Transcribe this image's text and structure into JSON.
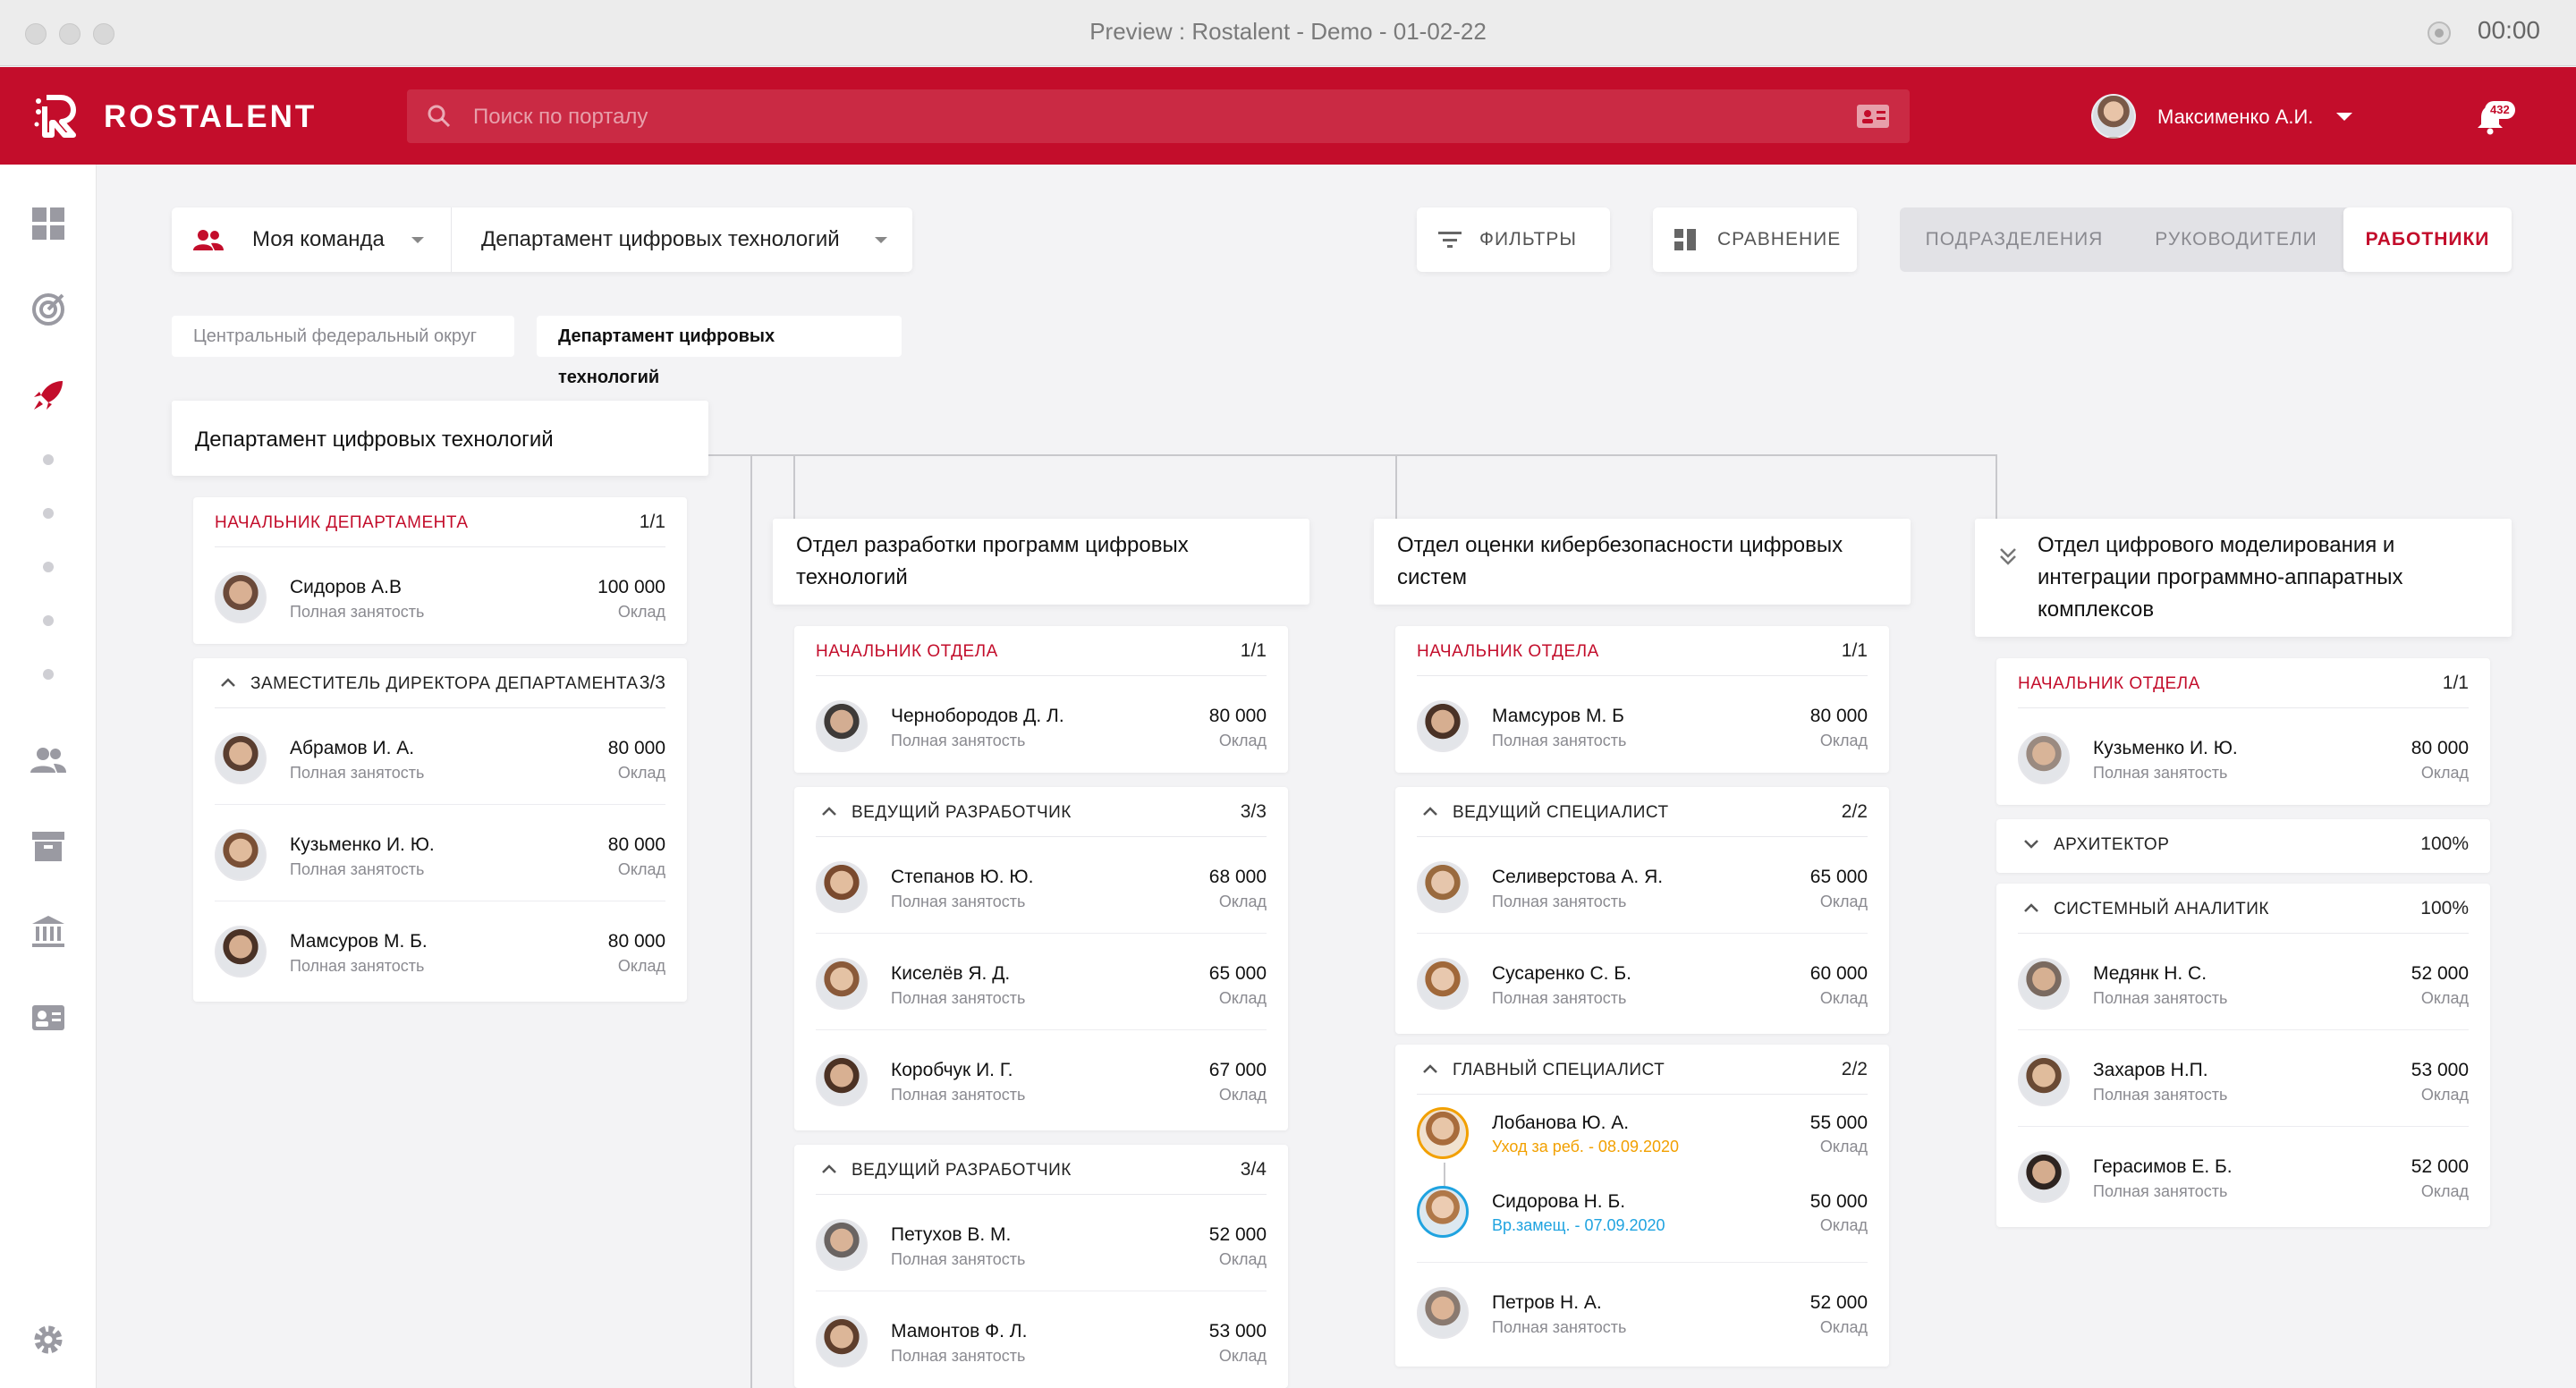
{
  "window": {
    "title": "Preview : Rostalent - Demo - 01-02-22",
    "timer": "00:00"
  },
  "app": {
    "brand": "ROSTALENT",
    "search_placeholder": "Поиск по порталу",
    "user_name": "Максименко А.И.",
    "notifications": "432"
  },
  "sidebar": {
    "icons": [
      "dashboard-icon",
      "target-icon",
      "rocket-icon",
      "team-icon",
      "archive-icon",
      "bank-icon",
      "id-card-icon",
      "settings-icon"
    ],
    "active": "rocket-icon"
  },
  "toolbar": {
    "team_select": "Моя команда",
    "dept_select": "Департамент цифровых технологий",
    "filters": "ФИЛЬТРЫ",
    "compare": "СРАВНЕНИЕ",
    "views": [
      "ПОДРАЗДЕЛЕНИЯ",
      "РУКОВОДИТЕЛИ",
      "РАБОТНИКИ"
    ],
    "active_view": "РАБОТНИКИ"
  },
  "breadcrumbs": [
    "Центральный федеральный округ",
    "Департамент цифровых технологий"
  ],
  "labels": {
    "employment": "Полная занятость",
    "salary": "Оклад"
  },
  "columns": [
    {
      "title": "Департамент цифровых технологий",
      "groups": [
        {
          "title": "НАЧАЛЬНИК ДЕПАРТАМЕНТА",
          "count": "1/1",
          "red": true,
          "employees": [
            {
              "name": "Сидоров А.В",
              "salary": "100 000"
            }
          ]
        },
        {
          "title": "ЗАМЕСТИТЕЛЬ ДИРЕКТОРА ДЕПАРТАМЕНТА",
          "count": "3/3",
          "red": false,
          "employees": [
            {
              "name": "Абрамов И. А.",
              "salary": "80 000"
            },
            {
              "name": "Кузьменко И. Ю.",
              "salary": "80 000"
            },
            {
              "name": "Мамсуров М. Б.",
              "salary": "80 000"
            }
          ]
        }
      ]
    },
    {
      "title": "Отдел разработки программ цифровых технологий",
      "groups": [
        {
          "title": "НАЧАЛЬНИК ОТДЕЛА",
          "count": "1/1",
          "red": true,
          "employees": [
            {
              "name": "Чернобородов Д. Л.",
              "salary": "80 000"
            }
          ]
        },
        {
          "title": "ВЕДУЩИЙ РАЗРАБОТЧИК",
          "count": "3/3",
          "red": false,
          "employees": [
            {
              "name": "Степанов Ю. Ю.",
              "salary": "68 000"
            },
            {
              "name": "Киселёв Я. Д.",
              "salary": "65 000"
            },
            {
              "name": "Коробчук И. Г.",
              "salary": "67 000"
            }
          ]
        },
        {
          "title": "ВЕДУЩИЙ РАЗРАБОТЧИК",
          "count": "3/4",
          "red": false,
          "employees": [
            {
              "name": "Петухов В. М.",
              "salary": "52 000"
            },
            {
              "name": "Мамонтов Ф. Л.",
              "salary": "53 000"
            }
          ]
        }
      ]
    },
    {
      "title": "Отдел оценки кибербезопасности цифровых систем",
      "groups": [
        {
          "title": "НАЧАЛЬНИК ОТДЕЛА",
          "count": "1/1",
          "red": true,
          "employees": [
            {
              "name": "Мамсуров М. Б",
              "salary": "80 000"
            }
          ]
        },
        {
          "title": "ВЕДУЩИЙ СПЕЦИАЛИСТ",
          "count": "2/2",
          "red": false,
          "employees": [
            {
              "name": "Селиверстова А. Я.",
              "salary": "65 000"
            },
            {
              "name": "Сусаренко С. Б.",
              "salary": "60 000"
            }
          ]
        },
        {
          "title": "ГЛАВНЫЙ СПЕЦИАЛИСТ",
          "count": "2/2",
          "red": false,
          "employees": [
            {
              "name": "Лобанова Ю. А.",
              "salary": "55 000",
              "status": "Уход за реб. - 08.09.2020",
              "status_color": "#f2a000"
            },
            {
              "name": "Сидорова Н. Б.",
              "salary": "50 000",
              "status": "Вр.замещ. - 07.09.2020",
              "status_color": "#1fa3e0"
            },
            {
              "name": "Петров Н. А.",
              "salary": "52 000"
            }
          ]
        }
      ]
    },
    {
      "title": "Отдел цифрового моделирования и интеграции программно-аппаратных комплексов",
      "groups": [
        {
          "title": "НАЧАЛЬНИК ОТДЕЛА",
          "count": "1/1",
          "red": true,
          "employees": [
            {
              "name": "Кузьменко И. Ю.",
              "salary": "80 000"
            }
          ]
        },
        {
          "title": "АРХИТЕКТОР",
          "count": "100%",
          "red": false,
          "collapsed": true,
          "employees": []
        },
        {
          "title": "СИСТЕМНЫЙ АНАЛИТИК",
          "count": "100%",
          "red": false,
          "employees": [
            {
              "name": "Медянк Н. С.",
              "salary": "52 000"
            },
            {
              "name": "Захаров Н.П.",
              "salary": "53 000"
            },
            {
              "name": "Герасимов Е. Б.",
              "salary": "52 000"
            }
          ]
        }
      ]
    }
  ],
  "colors": {
    "brand": "#c30d2b",
    "leave": "#f2a000",
    "substitute": "#1fa3e0"
  }
}
